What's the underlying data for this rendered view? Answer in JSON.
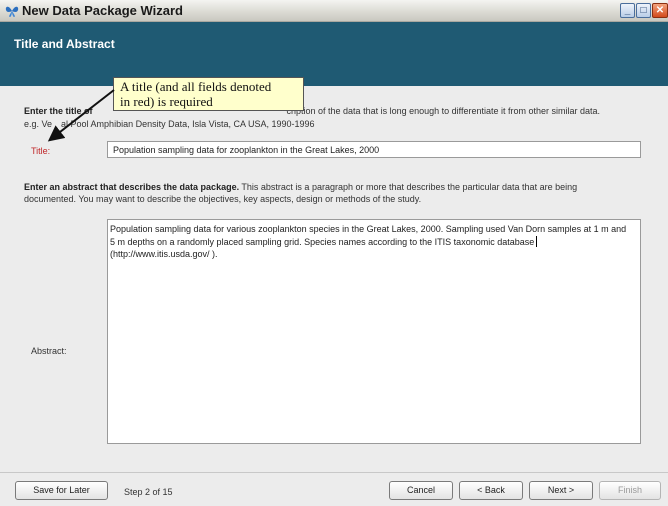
{
  "window": {
    "title": "New Data Package Wizard",
    "min_glyph": "_",
    "max_glyph": "□",
    "close_glyph": "✕"
  },
  "header": {
    "title": "Title and Abstract"
  },
  "title_section": {
    "instruction_bold_a": "Enter the title of",
    "instruction_tail": "cription of the data that is long enough to differentiate it from other similar data.",
    "example_a": "e.g. Ve",
    "example_b": "al Pool Amphibian Density Data, Isla Vista, CA USA, 1990-1996",
    "label": "Title:",
    "value": "Population sampling data for zooplankton in the Great Lakes,  2000"
  },
  "tooltip": {
    "line1": "A title (and all fields denoted",
    "line2": "in red) is required"
  },
  "abstract_section": {
    "instruction_bold": "Enter an abstract that describes the data package.",
    "instruction_rest": " This abstract is a paragraph or more that describes the particular data that are being",
    "instruction_line2": "documented. You may want to describe the objectives, key aspects, design or methods of the study.",
    "label": "Abstract:",
    "lines": [
      "Population sampling data for various zooplankton species in the Great Lakes, 2000. Sampling used Van Dorn samples at 1 m and",
      "5 m depths on a randomly placed sampling grid.  Species names according to the ITIS taxonomic database",
      "(http://www.itis.usda.gov/ )."
    ]
  },
  "footer": {
    "save_label": "Save for Later",
    "step_text": "Step 2 of 15",
    "cancel_label": "Cancel",
    "back_label": "< Back",
    "next_label": "Next >",
    "finish_label": "Finish"
  },
  "colors": {
    "header_bg": "#1f5a73",
    "required_red": "#c0282a",
    "tooltip_bg": "#ffffcc"
  }
}
